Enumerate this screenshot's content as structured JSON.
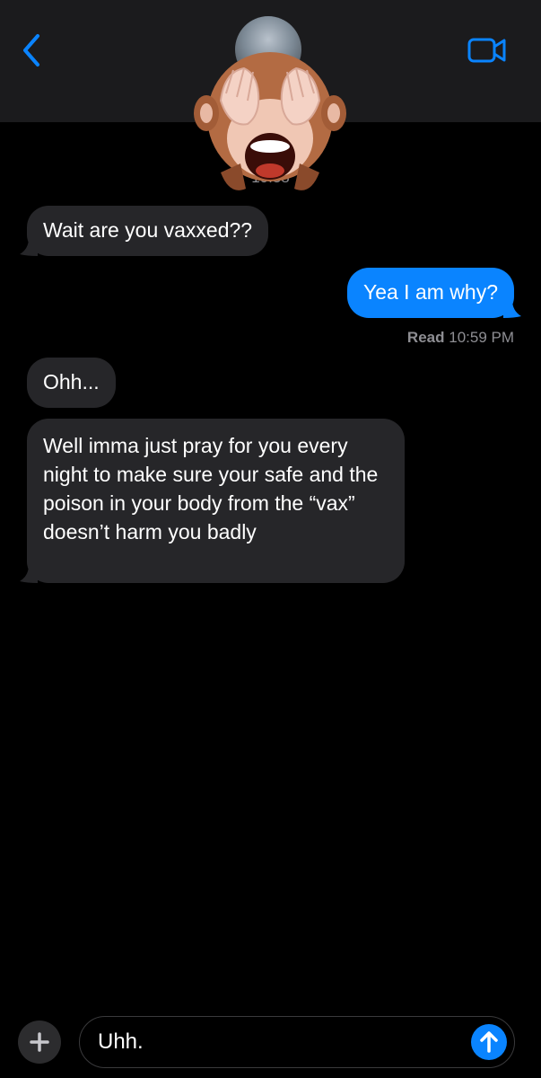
{
  "header": {
    "back_icon": "chevron-left-icon",
    "video_icon": "video-camera-icon",
    "accent_color": "#0a84ff"
  },
  "conversation": {
    "timestamp_partial": "10:58",
    "messages": [
      {
        "direction": "incoming",
        "text": "Wait are you vaxxed??"
      },
      {
        "direction": "outgoing",
        "text": "Yea I am why?"
      },
      {
        "direction": "incoming",
        "text": "Ohh..."
      },
      {
        "direction": "incoming",
        "text": "Well imma just pray for you every night to make sure your safe and the poison in your body from the “vax” doesn’t harm you badly"
      }
    ],
    "read_receipt": {
      "status": "Read",
      "time": "10:59 PM"
    }
  },
  "composer": {
    "plus_icon": "plus-icon",
    "draft_text": "Uhh.",
    "send_icon": "arrow-up-icon"
  }
}
